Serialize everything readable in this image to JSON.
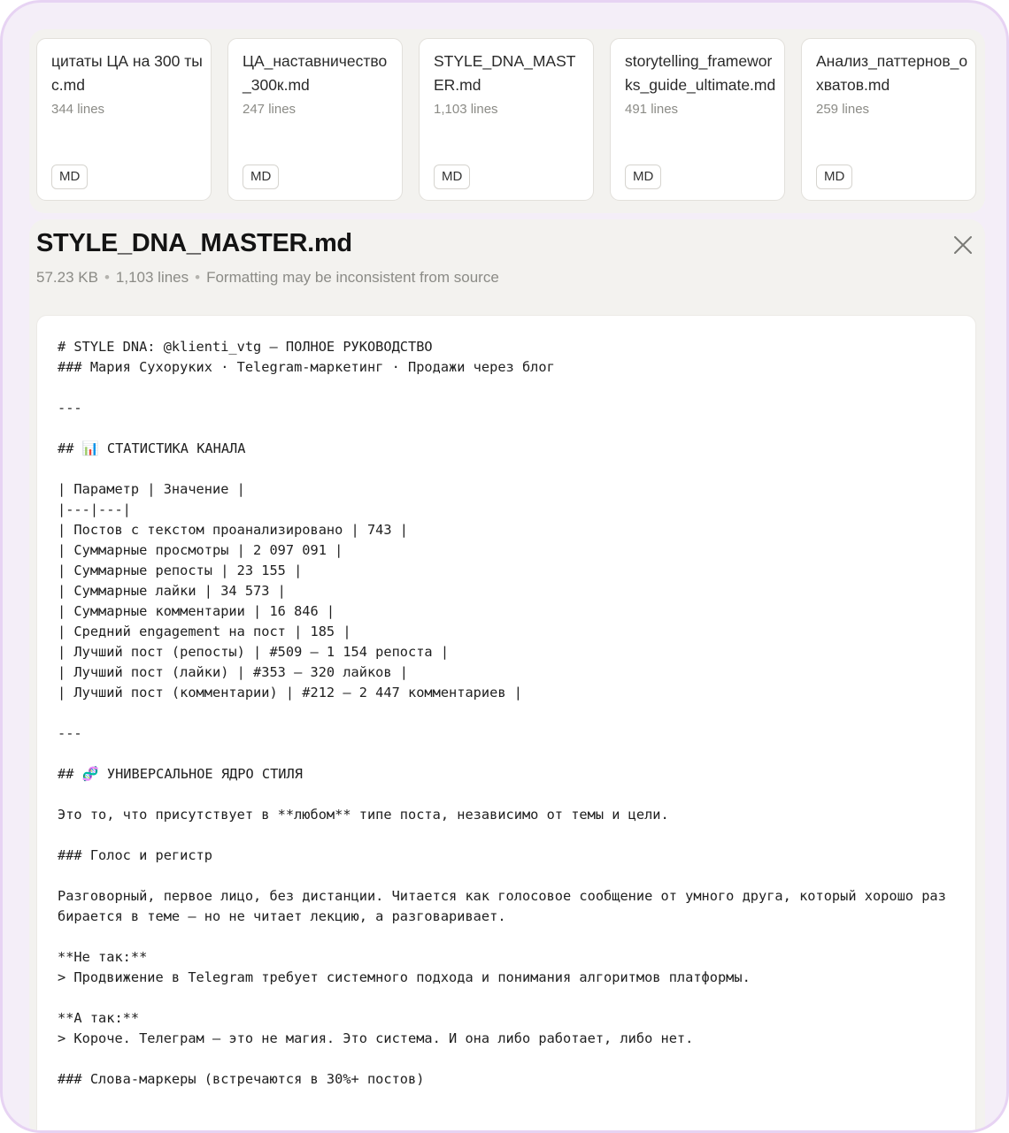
{
  "attachments": [
    {
      "name": "цитаты ЦА на 300 тыс.md",
      "lines": "344 lines",
      "badge": "MD"
    },
    {
      "name": "ЦА_наставничество_300к.md",
      "lines": "247 lines",
      "badge": "MD"
    },
    {
      "name": "STYLE_DNA_MASTER.md",
      "lines": "1,103 lines",
      "badge": "MD"
    },
    {
      "name": "storytelling_frameworks_guide_ultimate.md",
      "lines": "491 lines",
      "badge": "MD"
    },
    {
      "name": "Анализ_паттернов_охватов.md",
      "lines": "259 lines",
      "badge": "MD"
    }
  ],
  "viewer": {
    "title": "STYLE_DNA_MASTER.md",
    "size": "57.23 KB",
    "line_count": "1,103 lines",
    "note": "Formatting may be inconsistent from source",
    "close_icon": "close-icon",
    "lines": [
      "# STYLE DNA: @klienti_vtg — ПОЛНОЕ РУКОВОДСТВО",
      "### Мария Сухоруких · Telegram-маркетинг · Продажи через блог",
      "",
      "---",
      "",
      "## 📊 СТАТИСТИКА КАНАЛА",
      "",
      "| Параметр | Значение |",
      "|---|---|",
      "| Постов с текстом проанализировано | 743 |",
      "| Суммарные просмотры | 2 097 091 |",
      "| Суммарные репосты | 23 155 |",
      "| Суммарные лайки | 34 573 |",
      "| Суммарные комментарии | 16 846 |",
      "| Средний engagement на пост | 185 |",
      "| Лучший пост (репосты) | #509 — 1 154 репоста |",
      "| Лучший пост (лайки) | #353 — 320 лайков |",
      "| Лучший пост (комментарии) | #212 — 2 447 комментариев |",
      "",
      "---",
      "",
      "## 🧬 УНИВЕРСАЛЬНОЕ ЯДРО СТИЛЯ",
      "",
      "Это то, что присутствует в **любом** типе поста, независимо от темы и цели.",
      "",
      "### Голос и регистр",
      "",
      "Разговорный, первое лицо, без дистанции. Читается как голосовое сообщение от умного друга, который хорошо разбирается в теме — но не читает лекцию, а разговаривает.",
      "",
      "**Не так:**",
      "> Продвижение в Telegram требует системного подхода и понимания алгоритмов платформы.",
      "",
      "**А так:**",
      "> Короче. Телеграм — это не магия. Это система. И она либо работает, либо нет.",
      "",
      "### Слова-маркеры (встречаются в 30%+ постов)"
    ]
  }
}
